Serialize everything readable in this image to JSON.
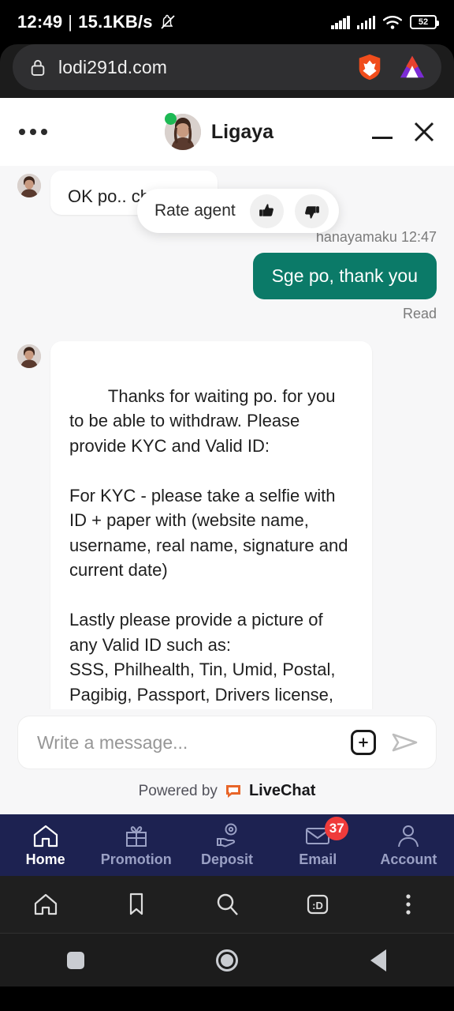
{
  "status_bar": {
    "time": "12:49",
    "separator": "|",
    "network_speed": "15.1KB/s",
    "mute_icon": "bell-muted-icon",
    "signal_icon_1": "signal-bars-icon",
    "signal_icon_2": "signal-bars-icon",
    "wifi_icon": "wifi-icon",
    "battery_level": "52"
  },
  "browser": {
    "lock_icon": "lock-icon",
    "url": "lodi291d.com",
    "brave_shield_icon": "brave-lion-icon",
    "bat_rewards_icon": "bat-triangle-icon",
    "toolbar": [
      {
        "name": "home-icon",
        "label": "Home"
      },
      {
        "name": "bookmark-icon",
        "label": "Bookmarks"
      },
      {
        "name": "search-icon",
        "label": "Search"
      },
      {
        "name": "tabs-icon",
        "label": ":D"
      },
      {
        "name": "more-vertical-icon",
        "label": "More"
      }
    ]
  },
  "system_nav": [
    {
      "name": "recents-button",
      "label": "Recents"
    },
    {
      "name": "home-button",
      "label": "Home"
    },
    {
      "name": "back-button",
      "label": "Back"
    }
  ],
  "chat_widget": {
    "menu_icon": "ellipsis-icon",
    "agent_name": "Ligaya",
    "agent_avatar": "agent-avatar",
    "online_status": "online",
    "minimize_label": "Minimize",
    "close_label": "Close",
    "rate_tooltip": {
      "label": "Rate agent",
      "thumbs_up_icon": "thumbs-up-icon",
      "thumbs_down_icon": "thumbs-down-icon"
    },
    "messages": [
      {
        "sender": "agent",
        "text": "OK po.. checking",
        "clipped": true
      },
      {
        "sender": "visitor",
        "meta": "hanayamaku 12:47",
        "text": "Sge po, thank you",
        "receipt": "Read"
      },
      {
        "sender": "agent",
        "text": "Thanks for waiting po. for you to be able to withdraw. Please provide KYC and Valid ID:\n\nFor KYC - please take a selfie with ID + paper with (website name, username, real name, signature and current date)\n\nLastly please provide a picture of any Valid ID such as:\nSSS, Philhealth, Tin, Umid, Postal, Pagibig, Passport, Drivers license, Senior Citizen, National id.\n\nMake sure that the ID is readable and corner to corner."
      }
    ],
    "composer": {
      "placeholder": "Write a message...",
      "attach_icon": "plus-icon",
      "send_icon": "send-icon"
    },
    "footer": {
      "powered_by": "Powered by",
      "brand_icon": "livechat-bubble-icon",
      "brand": "LiveChat"
    }
  },
  "site_nav": [
    {
      "name": "nav-home",
      "label": "Home",
      "icon": "house-icon",
      "active": true,
      "badge": ""
    },
    {
      "name": "nav-promotion",
      "label": "Promotion",
      "icon": "gift-icon",
      "active": false,
      "badge": ""
    },
    {
      "name": "nav-deposit",
      "label": "Deposit",
      "icon": "hand-coin-icon",
      "active": false,
      "badge": ""
    },
    {
      "name": "nav-email",
      "label": "Email",
      "icon": "envelope-icon",
      "active": false,
      "badge": "37"
    },
    {
      "name": "nav-account",
      "label": "Account",
      "icon": "person-icon",
      "active": false,
      "badge": ""
    }
  ],
  "colors": {
    "visitor_bubble": "#0b7a68",
    "site_nav_bg": "#1d2251",
    "badge_red": "#ef3b3b",
    "online_green": "#1db954",
    "brand_orange": "#e8662a"
  }
}
